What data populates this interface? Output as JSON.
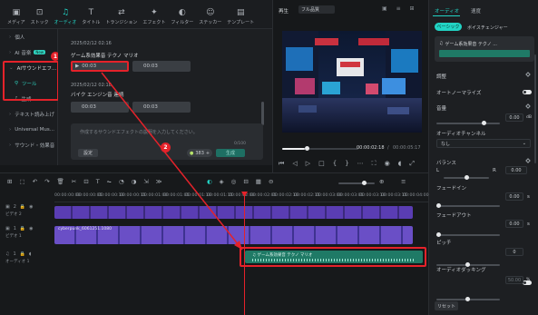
{
  "toolbar": {
    "items": [
      {
        "label": "メディア",
        "icon": "▣",
        "name": "media"
      },
      {
        "label": "ストック",
        "icon": "⊡",
        "name": "stock"
      },
      {
        "label": "オーディオ",
        "icon": "♫",
        "name": "audio"
      },
      {
        "label": "タイトル",
        "icon": "T",
        "name": "title"
      },
      {
        "label": "トランジション",
        "icon": "⇄",
        "name": "transition"
      },
      {
        "label": "エフェクト",
        "icon": "✦",
        "name": "effect"
      },
      {
        "label": "フィルター",
        "icon": "◐",
        "name": "filter"
      },
      {
        "label": "ステッカー",
        "icon": "☺",
        "name": "sticker"
      },
      {
        "label": "テンプレート",
        "icon": "▤",
        "name": "template"
      }
    ],
    "active_index": 2
  },
  "sidebar": {
    "items": [
      {
        "label": "個人",
        "type": "group"
      },
      {
        "label": "AI 音楽",
        "type": "group",
        "badge": "New"
      },
      {
        "label": "AIサウンドエフ...",
        "type": "group"
      },
      {
        "label": "ツール",
        "type": "sub",
        "selected": true
      },
      {
        "label": "生成",
        "type": "sub"
      },
      {
        "label": "テキスト読み上げ",
        "type": "group"
      },
      {
        "label": "Universal Mus...",
        "type": "group"
      },
      {
        "label": "サウンド・効果音",
        "type": "group"
      }
    ]
  },
  "sound_list": {
    "entries": [
      {
        "date": "2025/02/12 02:16",
        "title": "ゲーム系効果音 テクノ マリオ",
        "clips": [
          "00:03",
          "00:03"
        ]
      },
      {
        "date": "2025/02/12 02:18",
        "title": "バイク エンジン音 連続",
        "clips": [
          "00:03",
          "00:03"
        ]
      }
    ]
  },
  "prompt": {
    "placeholder": "作成するサウンドエフェクトの説明を入力してください。",
    "char_count": "0/100",
    "settings_label": "設定",
    "credits": "383",
    "generate_label": "生成"
  },
  "annotations": {
    "step1": "1",
    "step2": "2"
  },
  "player": {
    "tab_label": "再生",
    "quality": "フル品質",
    "current_time": "00:00:02:18",
    "total_time": "00:00:05:17",
    "progress": 0.18
  },
  "right_panel": {
    "tabs": [
      "オーディオ",
      "速度"
    ],
    "subtabs": [
      "ベーシック",
      "ボイスチェンジャー"
    ],
    "clip_name": "ゲーム系効果音 テクノ ...",
    "adjust_label": "調整",
    "auto_normalize": "オートノーマライズ",
    "volume_label": "音量",
    "volume_value": "0.00",
    "volume_unit": "dB",
    "channel_label": "オーディオチャンネル",
    "channel_value": "なし",
    "balance_label": "バランス",
    "balance_l": "L",
    "balance_r": "R",
    "balance_value": "0.00",
    "fade_in_label": "フェードイン",
    "fade_in_value": "0.00",
    "fade_in_unit": "s",
    "fade_out_label": "フェードアウト",
    "fade_out_value": "0.00",
    "fade_out_unit": "s",
    "pitch_label": "ピッチ",
    "pitch_value": "0",
    "ducking_label": "オーディオダッキング",
    "ducking_value": "50.00",
    "ducking_unit": "%",
    "reset_label": "リセット"
  },
  "timeline": {
    "timecodes": [
      "00:00:00:00",
      "00:00:00:05",
      "00:00:00:10",
      "00:00:00:15",
      "00:00:01:00",
      "00:00:01:05",
      "00:00:01:10",
      "00:00:01:15",
      "00:00:02:00",
      "00:00:02:05",
      "00:00:02:10",
      "00:00:02:15",
      "00:00:03:00",
      "00:00:03:05",
      "00:00:03:10",
      "00:00:03:15",
      "00:00:04:00"
    ],
    "tracks": [
      {
        "label": "ビデオ 2",
        "num": "2"
      },
      {
        "label": "ビデオ 1",
        "num": "1"
      },
      {
        "label": "オーディオ 1",
        "num": "1"
      }
    ],
    "video2_clip": "",
    "video1_clip": "cyberpunk_6061251.1080",
    "audio_clip": "ゲーム系効果音 テクノ マリオ"
  },
  "colors": {
    "accent": "#22d3c4",
    "highlight": "#e5222a",
    "video_clip": "#5a3db3",
    "audio_clip": "#1f7a66"
  }
}
